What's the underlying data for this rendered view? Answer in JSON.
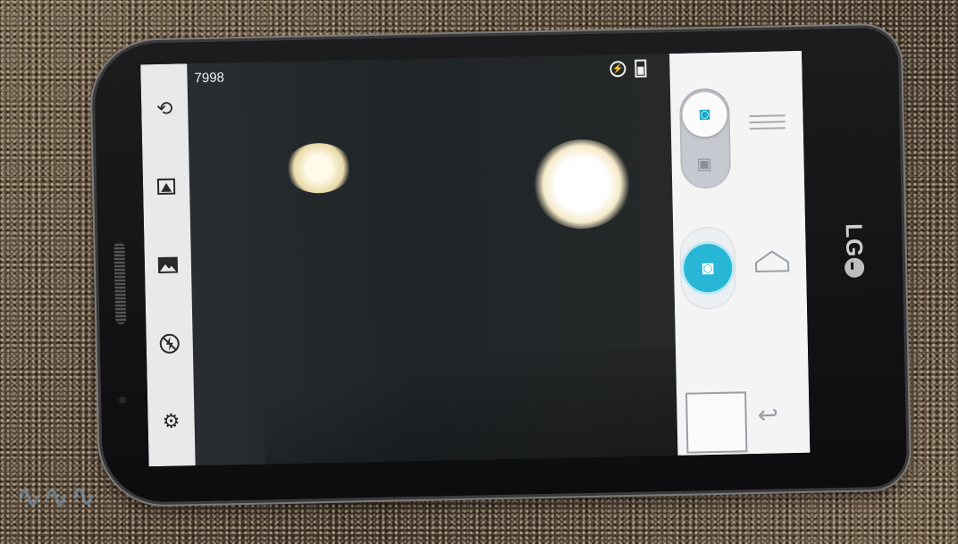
{
  "camera": {
    "shot_counter": "7998"
  },
  "device": {
    "brand": "LG"
  },
  "left_toolbar": {
    "items": [
      {
        "name": "switch-camera-icon"
      },
      {
        "name": "scene-mode-icon"
      },
      {
        "name": "gallery-icon"
      },
      {
        "name": "flash-off-icon"
      },
      {
        "name": "settings-icon"
      }
    ]
  },
  "status_bar": {
    "icons": [
      "flash-off-icon",
      "battery-icon"
    ]
  },
  "right_panel": {
    "mode_switch": {
      "selected": "photo",
      "options": [
        "photo",
        "video"
      ]
    },
    "nav": [
      "menu-icon",
      "home-icon",
      "back-icon"
    ]
  },
  "colors": {
    "accent": "#28b6d6",
    "panel_bg": "#f4f4f4",
    "toolbar_bg": "#e9e9e9"
  }
}
